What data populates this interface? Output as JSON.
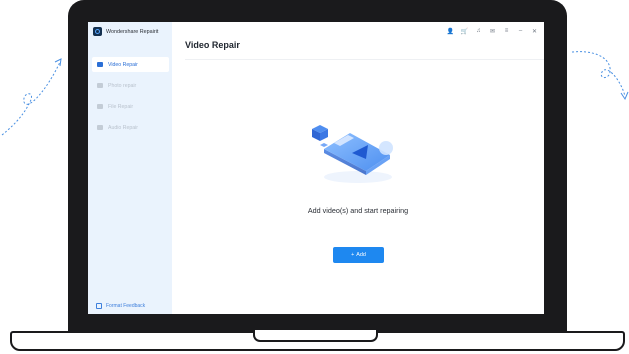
{
  "app": {
    "name": "Wondershare Repairit"
  },
  "sidebar": {
    "items": [
      {
        "label": "Video Repair",
        "active": true
      },
      {
        "label": "Photo repair",
        "active": false
      },
      {
        "label": "File Repair",
        "active": false
      },
      {
        "label": "Audio Repair",
        "active": false
      }
    ],
    "feedback_label": "Format Feedback"
  },
  "topbar": {
    "icons": [
      "account-icon",
      "cart-icon",
      "headset-icon",
      "mail-icon",
      "menu-icon",
      "minimize-icon",
      "close-icon"
    ],
    "glyphs": {
      "account": "👤",
      "cart": "🛒",
      "headset": "♫",
      "mail": "✉",
      "menu": "≡",
      "minimize": "–",
      "close": "✕"
    }
  },
  "main": {
    "title": "Video Repair",
    "empty_text": "Add video(s) and start repairing",
    "add_button": {
      "icon": "+",
      "label": "Add"
    }
  },
  "colors": {
    "accent": "#1e88f0",
    "sidebar_bg": "#eaf3fd",
    "active_text": "#2b6fd6",
    "bezel": "#1a1a1c"
  }
}
